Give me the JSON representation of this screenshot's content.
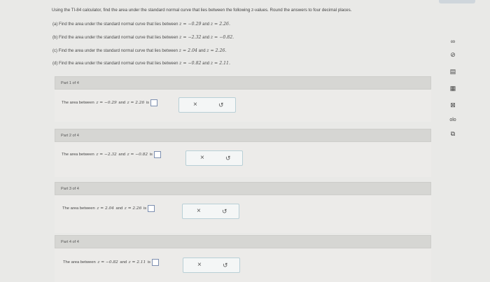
{
  "intro": "Using the TI-84 calculator, find the area under the standard normal curve that lies between the following z-values. Round the answers to four decimal places.",
  "questions": [
    {
      "label": "(a) Find the area under the standard normal curve that lies between",
      "z1": "z = −0.29",
      "and": "and",
      "z2": "z = 2.26."
    },
    {
      "label": "(b) Find the area under the standard normal curve that lies between",
      "z1": "z = −2.32",
      "and": "and",
      "z2": "z = −0.82."
    },
    {
      "label": "(c) Find the area under the standard normal curve that lies between",
      "z1": "z = 2.04",
      "and": "and",
      "z2": "z = 2.26."
    },
    {
      "label": "(d) Find the area under the standard normal curve that lies between",
      "z1": "z = −0.82",
      "and": "and",
      "z2": "z = 2.11."
    }
  ],
  "parts": [
    {
      "title": "Part 1 of 4",
      "prefix": "The area between",
      "z1": "z = −0.29",
      "and": "and",
      "z2": "z = 2.26",
      "suffix": "is"
    },
    {
      "title": "Part 2 of 4",
      "prefix": "The area between",
      "z1": "z = −2.32",
      "and": "and",
      "z2": "z = −0.82",
      "suffix": "is"
    },
    {
      "title": "Part 3 of 4",
      "prefix": "The area between",
      "z1": "z = 2.04",
      "and": "and",
      "z2": "z = 2.26",
      "suffix": "is"
    },
    {
      "title": "Part 4 of 4",
      "prefix": "The area between",
      "z1": "z = −0.82",
      "and": "and",
      "z2": "z = 2.11",
      "suffix": "is"
    }
  ],
  "buttons": {
    "clear": "×",
    "reset": "↺"
  },
  "rail_icons": [
    "∞",
    "⊘",
    "▤",
    "▦",
    "⊠",
    "olo",
    "⧉"
  ]
}
